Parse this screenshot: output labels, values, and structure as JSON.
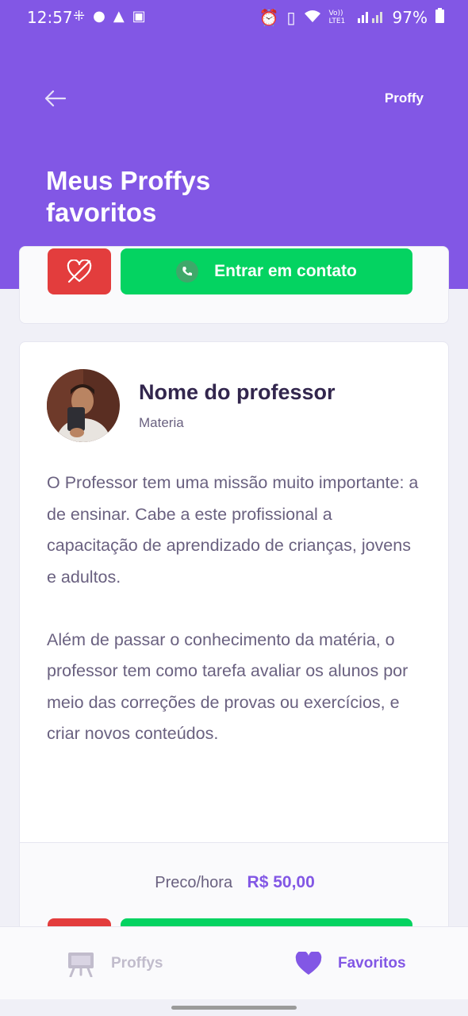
{
  "status_bar": {
    "time": "12:57",
    "lte_label": "Vo)) LTE1",
    "battery": "97%",
    "left_icons": [
      "grid-icon",
      "account-icon",
      "arrow-up-icon",
      "image-icon"
    ],
    "right_icons": [
      "alarm-icon",
      "vibrate-icon",
      "wifi-icon",
      "signal-icon",
      "battery-icon"
    ]
  },
  "header": {
    "brand": "Proffy",
    "title": "Meus Proffys favoritos",
    "back_icon": "arrow-left-icon"
  },
  "card_top": {
    "contact_label": "Entrar em contato",
    "unfavorite_icon": "heart-outline-icon",
    "whatsapp_icon": "whatsapp-icon"
  },
  "teacher_card": {
    "name": "Nome do professor",
    "subject": "Materia",
    "bio_paragraph_1": "O Professor tem uma missão muito importante: a de ensinar. Cabe a este profissional a capacitação de aprendizado de crianças, jovens e adultos.",
    "bio_paragraph_2": "Além de passar o conhecimento da matéria, o professor tem como tarefa avaliar os alunos por meio das correções de provas ou exercícios, e criar novos conteúdos.",
    "price_label": "Preco/hora",
    "price_value": "R$ 50,00"
  },
  "tabs": [
    {
      "label": "Proffys",
      "icon": "easel-icon",
      "active": false
    },
    {
      "label": "Favoritos",
      "icon": "heart-icon",
      "active": true
    }
  ],
  "colors": {
    "primary": "#8257E5",
    "whatsapp_green": "#04D361",
    "danger_red": "#E33D3D",
    "title_text": "#32264D",
    "body_text": "#6A6180",
    "inactive_tab": "#C1BCCC"
  }
}
